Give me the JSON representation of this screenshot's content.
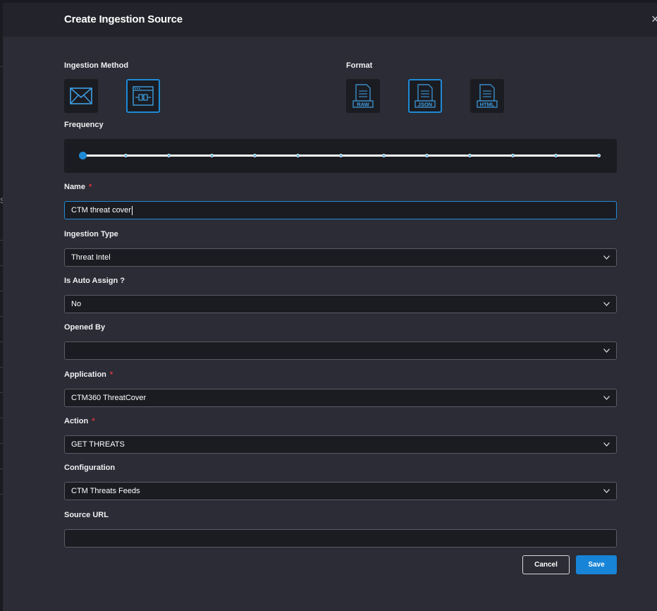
{
  "backdrop": {
    "edge_mark": "S"
  },
  "modal": {
    "title": "Create Ingestion Source",
    "close_glyph": "×"
  },
  "ingestion_method": {
    "label": "Ingestion Method",
    "options": [
      {
        "icon": "mail-icon",
        "selected": false
      },
      {
        "icon": "api-connector-icon",
        "selected": true
      }
    ]
  },
  "format": {
    "label": "Format",
    "options": [
      {
        "icon": "raw-file-icon",
        "text": "RAW",
        "selected": false
      },
      {
        "icon": "json-file-icon",
        "text": "JSON",
        "selected": true
      },
      {
        "icon": "html-file-icon",
        "text": "HTML",
        "selected": false
      }
    ]
  },
  "frequency": {
    "label": "Frequency",
    "stops": 13,
    "selected_index": 0
  },
  "fields": {
    "name": {
      "label": "Name",
      "required": "*",
      "value": "CTM threat cover"
    },
    "ingestion_type": {
      "label": "Ingestion Type",
      "value": "Threat Intel"
    },
    "auto_assign": {
      "label": "Is Auto Assign ?",
      "value": "No"
    },
    "opened_by": {
      "label": "Opened By",
      "value": ""
    },
    "application": {
      "label": "Application",
      "required": "*",
      "value": "CTM360 ThreatCover"
    },
    "action": {
      "label": "Action",
      "required": "*",
      "value": "GET THREATS"
    },
    "configuration": {
      "label": "Configuration",
      "value": "CTM Threats Feeds"
    },
    "source_url": {
      "label": "Source URL",
      "value": ""
    }
  },
  "buttons": {
    "cancel": "Cancel",
    "save": "Save"
  },
  "colors": {
    "accent": "#1e8ad6",
    "required": "#e0343f",
    "panel": "#2b2c35",
    "field_bg": "#1b1c22"
  }
}
